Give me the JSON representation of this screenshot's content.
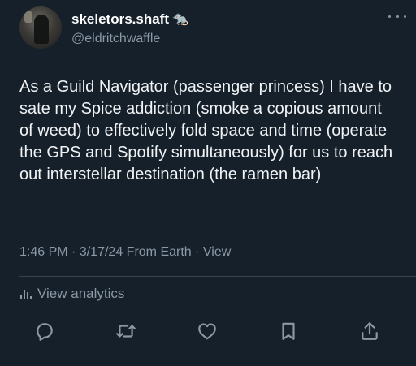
{
  "user": {
    "display_name": "skeletors.shaft",
    "name_emoji": "🐀",
    "handle": "@eldritchwaffle"
  },
  "tweet": {
    "text": "As a Guild Navigator (passenger princess) I have to sate my Spice addiction (smoke a copious amount of weed) to effectively fold space and time (operate the GPS and Spotify simultaneously) for us to reach out interstellar destination (the ramen bar)",
    "time": "1:46 PM",
    "date": "3/17/24",
    "source": "From Earth",
    "view_link": "View",
    "sep": "·"
  },
  "analytics": {
    "label": "View analytics",
    "icon": "bar-chart-icon"
  },
  "actions": {
    "icons": [
      "reply-icon",
      "retweet-icon",
      "like-icon",
      "bookmark-icon",
      "share-icon"
    ]
  },
  "colors": {
    "background": "#15202b",
    "text": "#e7e9ea",
    "secondary_text": "#8b98a5",
    "divider": "#38444d"
  }
}
